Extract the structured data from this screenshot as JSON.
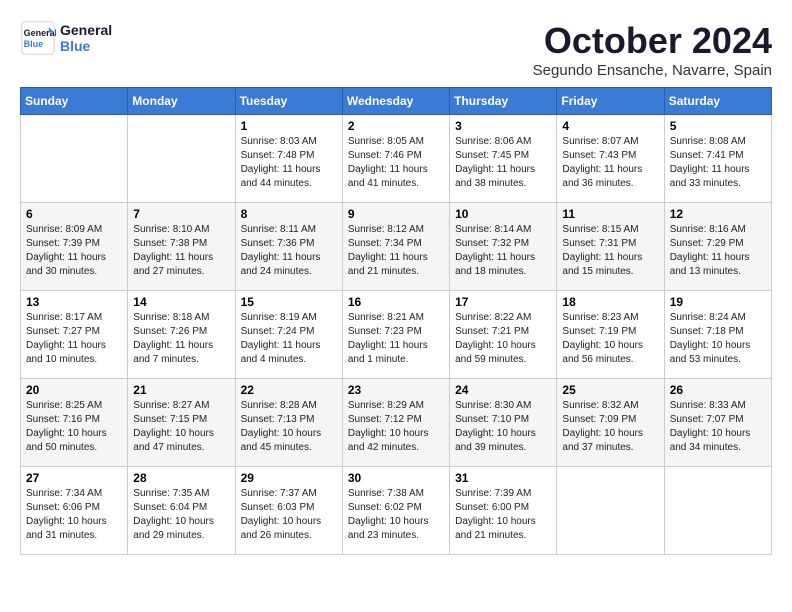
{
  "logo": {
    "line1": "General",
    "line2": "Blue"
  },
  "title": "October 2024",
  "subtitle": "Segundo Ensanche, Navarre, Spain",
  "weekdays": [
    "Sunday",
    "Monday",
    "Tuesday",
    "Wednesday",
    "Thursday",
    "Friday",
    "Saturday"
  ],
  "weeks": [
    [
      {
        "day": "",
        "info": ""
      },
      {
        "day": "",
        "info": ""
      },
      {
        "day": "1",
        "info": "Sunrise: 8:03 AM\nSunset: 7:48 PM\nDaylight: 11 hours and 44 minutes."
      },
      {
        "day": "2",
        "info": "Sunrise: 8:05 AM\nSunset: 7:46 PM\nDaylight: 11 hours and 41 minutes."
      },
      {
        "day": "3",
        "info": "Sunrise: 8:06 AM\nSunset: 7:45 PM\nDaylight: 11 hours and 38 minutes."
      },
      {
        "day": "4",
        "info": "Sunrise: 8:07 AM\nSunset: 7:43 PM\nDaylight: 11 hours and 36 minutes."
      },
      {
        "day": "5",
        "info": "Sunrise: 8:08 AM\nSunset: 7:41 PM\nDaylight: 11 hours and 33 minutes."
      }
    ],
    [
      {
        "day": "6",
        "info": "Sunrise: 8:09 AM\nSunset: 7:39 PM\nDaylight: 11 hours and 30 minutes."
      },
      {
        "day": "7",
        "info": "Sunrise: 8:10 AM\nSunset: 7:38 PM\nDaylight: 11 hours and 27 minutes."
      },
      {
        "day": "8",
        "info": "Sunrise: 8:11 AM\nSunset: 7:36 PM\nDaylight: 11 hours and 24 minutes."
      },
      {
        "day": "9",
        "info": "Sunrise: 8:12 AM\nSunset: 7:34 PM\nDaylight: 11 hours and 21 minutes."
      },
      {
        "day": "10",
        "info": "Sunrise: 8:14 AM\nSunset: 7:32 PM\nDaylight: 11 hours and 18 minutes."
      },
      {
        "day": "11",
        "info": "Sunrise: 8:15 AM\nSunset: 7:31 PM\nDaylight: 11 hours and 15 minutes."
      },
      {
        "day": "12",
        "info": "Sunrise: 8:16 AM\nSunset: 7:29 PM\nDaylight: 11 hours and 13 minutes."
      }
    ],
    [
      {
        "day": "13",
        "info": "Sunrise: 8:17 AM\nSunset: 7:27 PM\nDaylight: 11 hours and 10 minutes."
      },
      {
        "day": "14",
        "info": "Sunrise: 8:18 AM\nSunset: 7:26 PM\nDaylight: 11 hours and 7 minutes."
      },
      {
        "day": "15",
        "info": "Sunrise: 8:19 AM\nSunset: 7:24 PM\nDaylight: 11 hours and 4 minutes."
      },
      {
        "day": "16",
        "info": "Sunrise: 8:21 AM\nSunset: 7:23 PM\nDaylight: 11 hours and 1 minute."
      },
      {
        "day": "17",
        "info": "Sunrise: 8:22 AM\nSunset: 7:21 PM\nDaylight: 10 hours and 59 minutes."
      },
      {
        "day": "18",
        "info": "Sunrise: 8:23 AM\nSunset: 7:19 PM\nDaylight: 10 hours and 56 minutes."
      },
      {
        "day": "19",
        "info": "Sunrise: 8:24 AM\nSunset: 7:18 PM\nDaylight: 10 hours and 53 minutes."
      }
    ],
    [
      {
        "day": "20",
        "info": "Sunrise: 8:25 AM\nSunset: 7:16 PM\nDaylight: 10 hours and 50 minutes."
      },
      {
        "day": "21",
        "info": "Sunrise: 8:27 AM\nSunset: 7:15 PM\nDaylight: 10 hours and 47 minutes."
      },
      {
        "day": "22",
        "info": "Sunrise: 8:28 AM\nSunset: 7:13 PM\nDaylight: 10 hours and 45 minutes."
      },
      {
        "day": "23",
        "info": "Sunrise: 8:29 AM\nSunset: 7:12 PM\nDaylight: 10 hours and 42 minutes."
      },
      {
        "day": "24",
        "info": "Sunrise: 8:30 AM\nSunset: 7:10 PM\nDaylight: 10 hours and 39 minutes."
      },
      {
        "day": "25",
        "info": "Sunrise: 8:32 AM\nSunset: 7:09 PM\nDaylight: 10 hours and 37 minutes."
      },
      {
        "day": "26",
        "info": "Sunrise: 8:33 AM\nSunset: 7:07 PM\nDaylight: 10 hours and 34 minutes."
      }
    ],
    [
      {
        "day": "27",
        "info": "Sunrise: 7:34 AM\nSunset: 6:06 PM\nDaylight: 10 hours and 31 minutes."
      },
      {
        "day": "28",
        "info": "Sunrise: 7:35 AM\nSunset: 6:04 PM\nDaylight: 10 hours and 29 minutes."
      },
      {
        "day": "29",
        "info": "Sunrise: 7:37 AM\nSunset: 6:03 PM\nDaylight: 10 hours and 26 minutes."
      },
      {
        "day": "30",
        "info": "Sunrise: 7:38 AM\nSunset: 6:02 PM\nDaylight: 10 hours and 23 minutes."
      },
      {
        "day": "31",
        "info": "Sunrise: 7:39 AM\nSunset: 6:00 PM\nDaylight: 10 hours and 21 minutes."
      },
      {
        "day": "",
        "info": ""
      },
      {
        "day": "",
        "info": ""
      }
    ]
  ]
}
